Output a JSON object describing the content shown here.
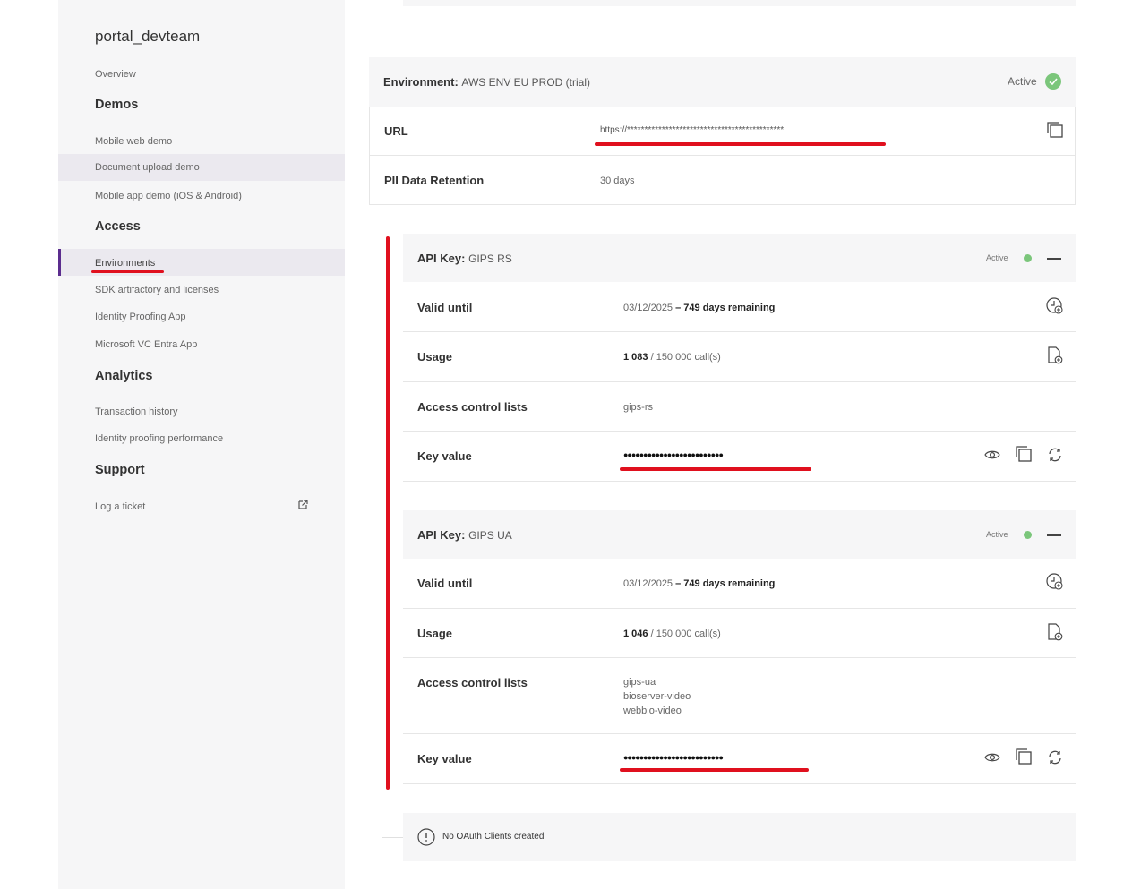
{
  "sidebar": {
    "title": "portal_devteam",
    "overview": "Overview",
    "sections": {
      "demos": "Demos",
      "access": "Access",
      "analytics": "Analytics",
      "support": "Support"
    },
    "items": {
      "mobile_web_demo": "Mobile web demo",
      "document_upload_demo": "Document upload demo",
      "mobile_app_demo": "Mobile app demo (iOS & Android)",
      "environments": "Environments",
      "sdk_artifactory": "SDK artifactory and licenses",
      "identity_proofing_app": "Identity Proofing App",
      "microsoft_vc": "Microsoft VC Entra App",
      "transaction_history": "Transaction history",
      "identity_proofing_performance": "Identity proofing performance",
      "log_ticket": "Log a ticket"
    },
    "active_item": "Environments"
  },
  "environment": {
    "label": "Environment:",
    "name": "AWS ENV EU PROD (trial)",
    "status": "Active",
    "url_label": "URL",
    "url_value": "https://*********************************************",
    "retention_label": "PII Data Retention",
    "retention_value": "30 days"
  },
  "api_keys": [
    {
      "label": "API Key:",
      "name": "GIPS RS",
      "status": "Active",
      "valid_label": "Valid until",
      "valid_date": "03/12/2025",
      "valid_sep": " – ",
      "valid_remaining": "749 days remaining",
      "usage_label": "Usage",
      "usage_used": "1 083",
      "usage_total": " / 150 000 call(s)",
      "acl_label": "Access control lists",
      "acl": [
        "gips-rs"
      ],
      "key_label": "Key value",
      "key_value": "●●●●●●●●●●●●●●●●●●●●●●●●●"
    },
    {
      "label": "API Key:",
      "name": "GIPS UA",
      "status": "Active",
      "valid_label": "Valid until",
      "valid_date": "03/12/2025",
      "valid_sep": " – ",
      "valid_remaining": "749 days remaining",
      "usage_label": "Usage",
      "usage_used": "1 046",
      "usage_total": " / 150 000 call(s)",
      "acl_label": "Access control lists",
      "acl": [
        "gips-ua",
        "bioserver-video",
        "webbio-video"
      ],
      "key_label": "Key value",
      "key_value": "●●●●●●●●●●●●●●●●●●●●●●●●●"
    }
  ],
  "oauth": {
    "message": "No OAuth Clients created"
  },
  "colors": {
    "accent": "#5b2d8e",
    "active_green": "#7bc67b",
    "annotation_red": "#e0101e"
  }
}
